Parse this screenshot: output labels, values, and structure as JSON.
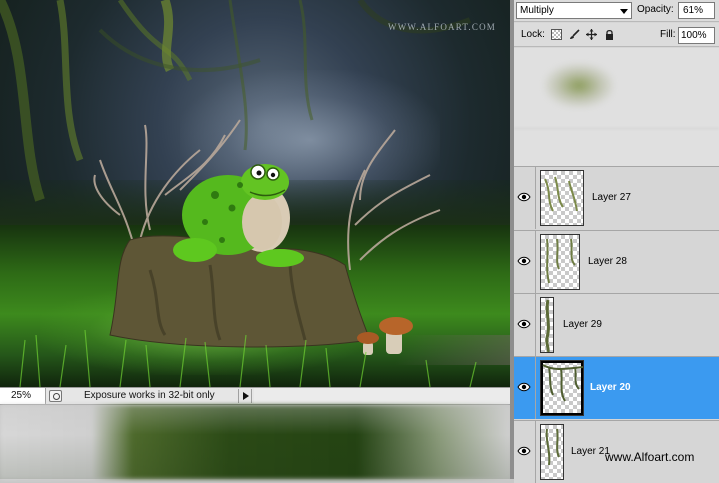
{
  "canvas": {
    "watermark": "WWW.ALFOART.COM"
  },
  "statusbar": {
    "zoom": "25%",
    "message": "Exposure works in 32-bit only"
  },
  "layers_panel": {
    "blend_mode": "Multiply",
    "opacity_label": "Opacity:",
    "opacity_value": "61%",
    "lock_label": "Lock:",
    "fill_label": "Fill:",
    "fill_value": "100%",
    "layers": [
      {
        "name": "Layer 27",
        "selected": false,
        "visible": true
      },
      {
        "name": "Layer 28",
        "selected": false,
        "visible": true
      },
      {
        "name": "Layer 29",
        "selected": false,
        "visible": true
      },
      {
        "name": "Layer 20",
        "selected": true,
        "visible": true
      },
      {
        "name": "Layer 21",
        "selected": false,
        "visible": true
      }
    ]
  },
  "credit": "www.Alfoart.com",
  "colors": {
    "selection": "#3b9af0",
    "panel_bg": "#d6d6d6"
  }
}
